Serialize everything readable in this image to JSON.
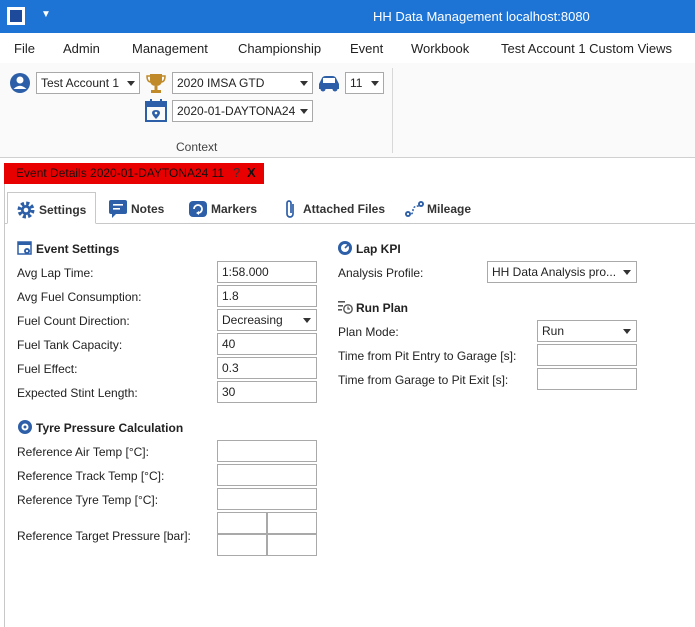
{
  "window": {
    "title": "HH Data Management localhost:8080",
    "quick_access_arrow": "▼"
  },
  "menu": [
    "File",
    "Admin",
    "Management",
    "Championship",
    "Event",
    "Workbook",
    "Test Account 1 Custom Views"
  ],
  "ribbon": {
    "account": "Test Account 1",
    "championship": "2020 IMSA GTD",
    "car": "11",
    "event": "2020-01-DAYTONA24",
    "group_label": "Context"
  },
  "document_tab": {
    "title": "Event Details 2020-01-DAYTONA24 11",
    "help": "?",
    "close": "X"
  },
  "tabs": [
    "Settings",
    "Notes",
    "Markers",
    "Attached Files",
    "Mileage"
  ],
  "event_settings": {
    "title": "Event Settings",
    "avg_lap_time": {
      "label": "Avg Lap Time:",
      "value": "1:58.000"
    },
    "avg_fuel": {
      "label": "Avg Fuel Consumption:",
      "value": "1.8"
    },
    "fuel_direction": {
      "label": "Fuel Count Direction:",
      "value": "Decreasing"
    },
    "fuel_tank": {
      "label": "Fuel Tank Capacity:",
      "value": "40"
    },
    "fuel_effect": {
      "label": "Fuel Effect:",
      "value": "0.3"
    },
    "stint_length": {
      "label": "Expected Stint Length:",
      "value": "30"
    }
  },
  "tyre_pressure": {
    "title": "Tyre Pressure Calculation",
    "ref_air_temp": {
      "label": "Reference Air Temp [°C]:",
      "value": ""
    },
    "ref_track_temp": {
      "label": "Reference Track Temp [°C]:",
      "value": ""
    },
    "ref_tyre_temp": {
      "label": "Reference Tyre Temp [°C]:",
      "value": ""
    },
    "ref_target_pressure": {
      "label": "Reference Target Pressure [bar]:",
      "values": [
        "",
        "",
        "",
        ""
      ]
    }
  },
  "lap_kpi": {
    "title": "Lap KPI",
    "analysis_profile": {
      "label": "Analysis Profile:",
      "value": "HH Data Analysis pro..."
    }
  },
  "run_plan": {
    "title": "Run Plan",
    "plan_mode": {
      "label": "Plan Mode:",
      "value": "Run"
    },
    "pit_entry": {
      "label": "Time from Pit Entry to Garage [s]:",
      "value": ""
    },
    "garage_exit": {
      "label": "Time from Garage to Pit Exit [s]:",
      "value": ""
    }
  },
  "colors": {
    "titlebar": "#1e74d4",
    "doc_tab": "#e80000",
    "accent_icon": "#2d5fa8",
    "trophy": "#c08a2a"
  }
}
